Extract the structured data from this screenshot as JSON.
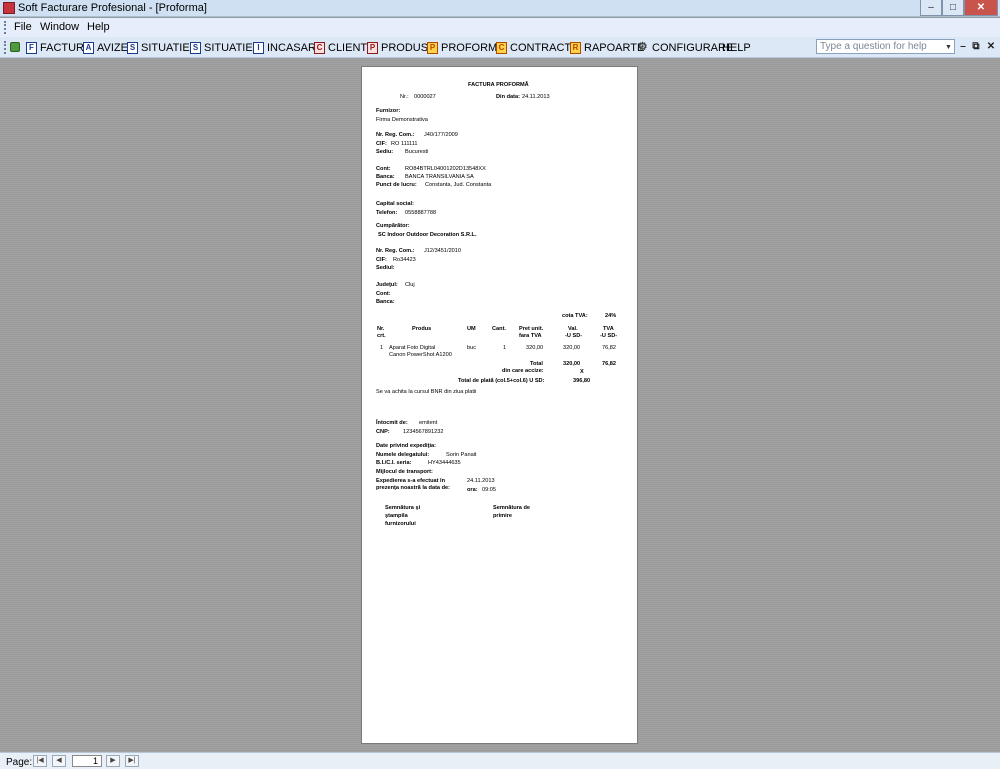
{
  "window": {
    "title": "Soft Facturare Profesional - [Proforma]"
  },
  "menu": [
    "File",
    "Window",
    "Help"
  ],
  "toolbar": [
    {
      "icon": "F",
      "label": "FACTURI"
    },
    {
      "icon": "A",
      "label": "AVIZE"
    },
    {
      "icon": "S",
      "label": "SITUATIE1"
    },
    {
      "icon": "S",
      "label": "SITUATIE2"
    },
    {
      "icon": "I",
      "label": "INCASARI"
    },
    {
      "icon": "C",
      "label": "CLIENTI"
    },
    {
      "icon": "P",
      "label": "PRODUSE"
    },
    {
      "icon": "P",
      "label": "PROFORME"
    },
    {
      "icon": "C",
      "label": "CONTRACTE"
    },
    {
      "icon": "R",
      "label": "RAPOARTE"
    },
    {
      "icon": "gear",
      "label": "CONFIGURARE"
    },
    {
      "icon": "",
      "label": "HELP"
    }
  ],
  "help_search": {
    "placeholder": "Type a question for help"
  },
  "document": {
    "title": "FACTURA PROFORMĂ",
    "nr_label": "Nr.:",
    "nr_value": "0000027",
    "date_label": "Din data:",
    "date_value": "24.11.2013",
    "supplier": {
      "heading": "Furnizor:",
      "name": "Firma Demonstrativa",
      "reg_label": "Nr. Reg. Com.:",
      "reg_value": "J40/177/2009",
      "cif_label": "CIF:",
      "cif_value": "RO 111111",
      "seat_label": "Sediu:",
      "seat_value": "Bucuresti",
      "account_label": "Cont:",
      "account_value": "RO84BTRL04001202D13548XX",
      "bank_label": "Banca:",
      "bank_value": "BANCA TRANSILVANIA SA",
      "workpoint_label": "Punct de lucru:",
      "workpoint_value": "Constanta, Jud. Constanta",
      "capital_label": "Capital social:",
      "phone_label": "Telefon:",
      "phone_value": "0558887788"
    },
    "buyer": {
      "heading": "Cumpărător:",
      "name": "SC Indoor Outdoor Decoration S.R.L.",
      "reg_label": "Nr. Reg. Com.:",
      "reg_value": "J12/3451/2010",
      "cif_label": "CIF:",
      "cif_value": "Ro34423",
      "seat_label": "Sediul:",
      "county_label": "Judeţul:",
      "county_value": "Cluj",
      "account_label": "Cont:",
      "bank_label": "Banca:"
    },
    "vat_rate_label": "cota TVA:",
    "vat_rate_value": "24%",
    "table_headers": {
      "nr_1": "Nr.",
      "nr_2": "crt.",
      "product": "Produs",
      "um": "UM",
      "qty": "Cant.",
      "price_1": "Pret unit.",
      "price_2": "fara TVA",
      "value_1": "Val.",
      "value_2": "-U SD-",
      "vat_1": "TVA",
      "vat_2": "-U SD-"
    },
    "rows": [
      {
        "nr": "1",
        "product_1": "Aparat Foto Digital",
        "product_2": "Canon PowerShot A1200",
        "um": "buc",
        "qty": "1",
        "price": "320,00",
        "value": "320,00",
        "vat": "76,82"
      }
    ],
    "total_label": "Total",
    "total_value": "320,00",
    "total_vat": "76,82",
    "excise_label": "din care accize:",
    "excise_value": "X",
    "grand_total_label": "Total de plată (col.5+col.6) U SD:",
    "grand_total_value": "396,80",
    "payment_note": "Se va achita la cursul BNR din ziua platii",
    "issuer_label": "Întocmit de:",
    "issuer_value": "emitent",
    "cnp_label": "CNP:",
    "cnp_value": "1234567891232",
    "shipping": {
      "heading": "Date privind expediţia:",
      "delegate_label": "Numele delegatului:",
      "delegate_value": "Sorin Panait",
      "id_label": "B.I./C.I. seria:",
      "id_value": "HY43444635",
      "transport_label": "Mijlocul de transport:",
      "shipped_label_1": "Expedierea s-a efectuat în",
      "shipped_label_2": "prezenţa noastră la data de:",
      "shipped_date": "24.11.2013",
      "time_label": "ora:",
      "time_value": "09:05"
    },
    "signature_supplier": [
      "Semnătura şi",
      "ştampila",
      "furnizorului"
    ],
    "signature_receipt": [
      "Semnătura de",
      "primire"
    ]
  },
  "statusbar": {
    "page_label": "Page:",
    "page_value": "1"
  }
}
